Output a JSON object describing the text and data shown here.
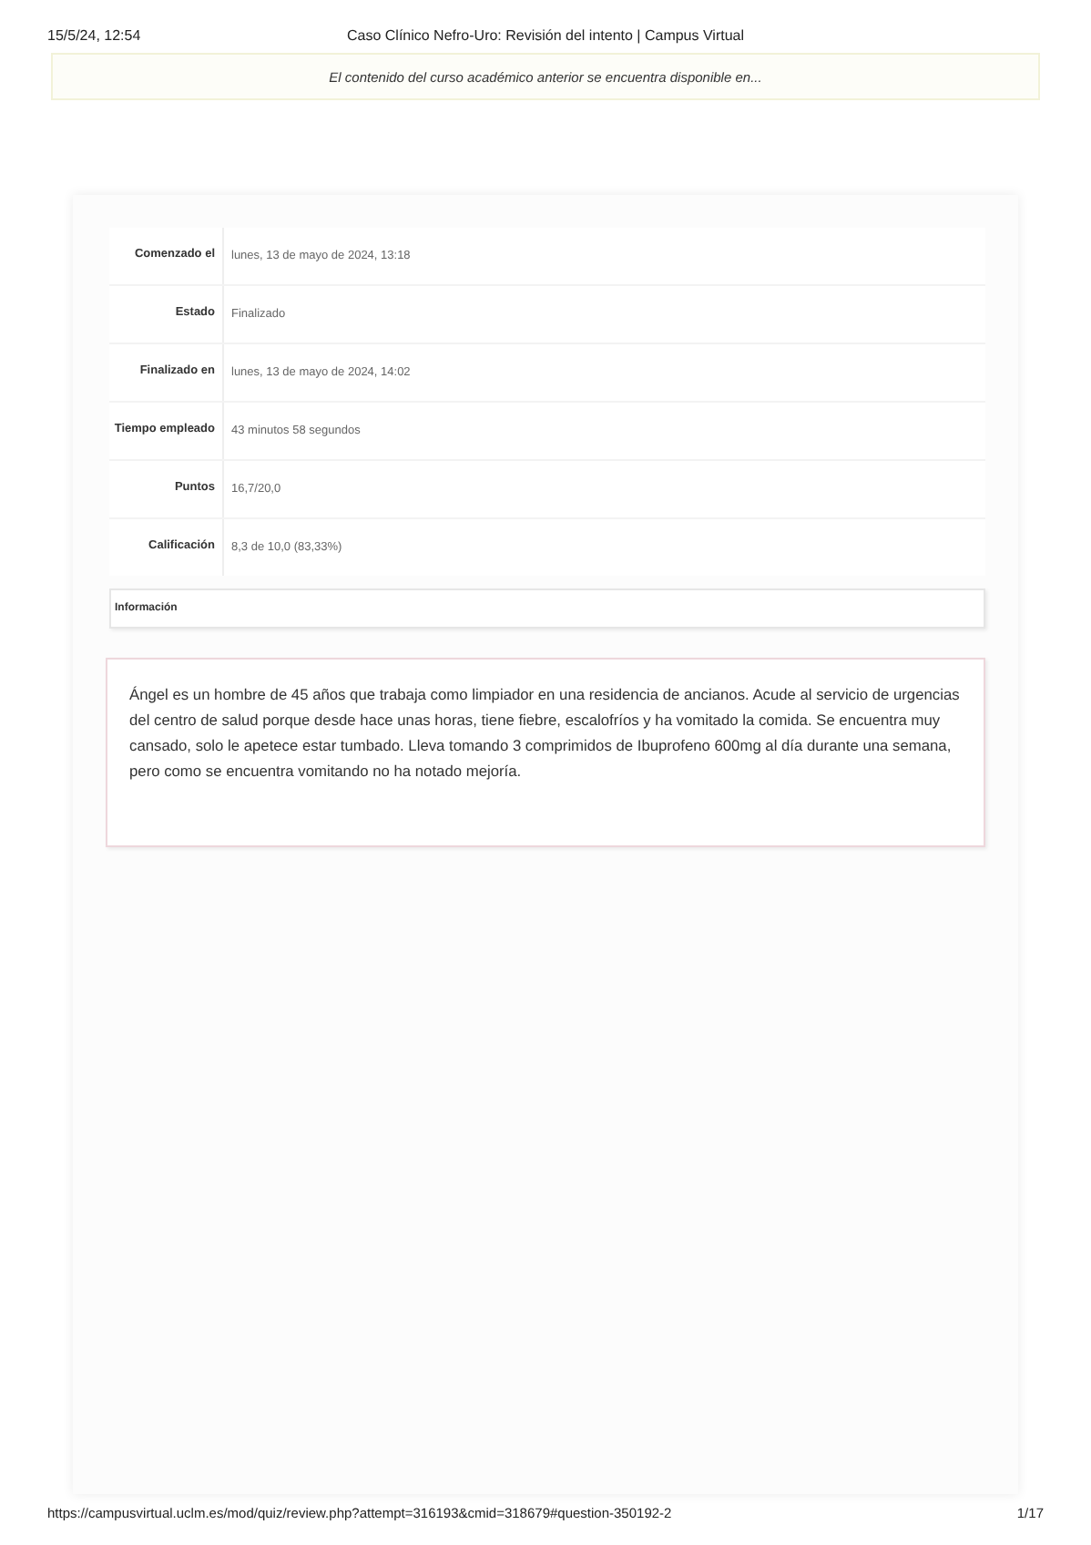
{
  "print_header": {
    "date": "15/5/24, 12:54",
    "title": "Caso Clínico Nefro-Uro: Revisión del intento | Campus Virtual"
  },
  "notice": "El contenido del curso académico anterior se encuentra disponible en...",
  "summary": [
    {
      "label": "Comenzado el",
      "value": "lunes, 13 de mayo de 2024, 13:18"
    },
    {
      "label": "Estado",
      "value": "Finalizado"
    },
    {
      "label": "Finalizado en",
      "value": "lunes, 13 de mayo de 2024, 14:02"
    },
    {
      "label": "Tiempo empleado",
      "value": "43 minutos 58 segundos"
    },
    {
      "label": "Puntos",
      "value": "16,7/20,0"
    },
    {
      "label": "Calificación",
      "value": "8,3 de 10,0 (83,33%)"
    }
  ],
  "info_heading": "Información",
  "question_text": "Ángel es un hombre de 45 años que trabaja como limpiador en una residencia de ancianos. Acude al servicio de urgencias del centro de salud porque desde hace unas horas, tiene fiebre, escalofríos y ha vomitado la comida. Se encuentra muy cansado, solo le apetece estar tumbado. Lleva tomando 3 comprimidos de Ibuprofeno 600mg al día durante una semana, pero como se encuentra vomitando no ha notado mejoría.",
  "print_footer": {
    "url": "https://campusvirtual.uclm.es/mod/quiz/review.php?attempt=316193&cmid=318679#question-350192-2",
    "page": "1/17"
  }
}
